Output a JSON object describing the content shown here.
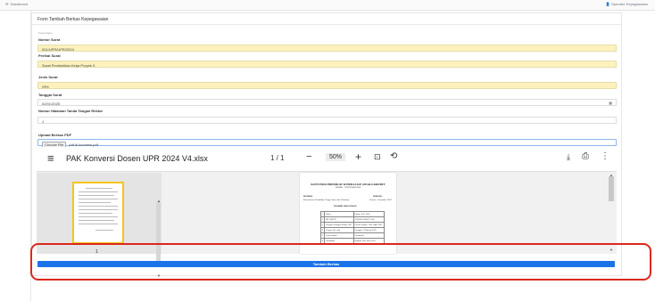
{
  "topbar": {
    "breadcrumb": "Dashboard",
    "user": "Operator Kepegawaian"
  },
  "form": {
    "header": "Form Tambah Berkas Kepegawaian",
    "section_label": "Keterangan",
    "nomor_surat": {
      "label": "Nomor Surat",
      "value": "001/UPR/UPR/2024"
    },
    "perihal_surat": {
      "label": "Perihal Surat",
      "value": "Surat Pembuktian Kerja Proyek X"
    },
    "jenis_surat": {
      "label": "Jenis Surat",
      "value": "SPK"
    },
    "tanggal_surat": {
      "label": "Tanggal Surat",
      "value": "02/01/2025"
    },
    "nomor_halaman": {
      "label": "Nomor Halaman Tanda Tangan Rektor",
      "value": "1"
    },
    "upload": {
      "label": "Upload Berkas PDF",
      "button": "Choose File",
      "filename": "pdf di konversi.pdf"
    },
    "submit_label": "Tambah Berkas"
  },
  "pdf_viewer": {
    "title": "PAK Konversi Dosen UPR 2024 V4.xlsx",
    "page_current": "1",
    "page_total": "1",
    "zoom": "50%",
    "thumbnail_page": "1",
    "document": {
      "heading": "KONVERSI PREDIKAT KINERJA KE ANGKA KREDIT",
      "subheading": "NOMOR : 1793/UN24/KP/2024",
      "instansi_label": "INSTANSI :",
      "instansi_value": "Kementerian Pendidikan Tinggi, Sains dan Teknologi",
      "periode_label": "PERIODE :",
      "periode_value": "Januari - Desember 2024",
      "table_header": "PEGAWAI YANG DINILAI",
      "rows": [
        {
          "no": "1",
          "key": "Nama",
          "val": "Fiason, S.Si., M.Sc"
        },
        {
          "no": "2",
          "key": "NIP / NUPTK",
          "val": "19790619 200501 1 004"
        },
        {
          "no": "3",
          "key": "Pangkat, Golongan Ruang, TMT",
          "val": "Penata Tingkat I, III/d, 1 April 2012"
        },
        {
          "no": "4",
          "key": "Tempat, Tgl. Lahir",
          "val": "Pronggo, 17 Februari 1979"
        },
        {
          "no": "5",
          "key": "Jenis Kelamin",
          "val": "Perempuan"
        },
        {
          "no": "6",
          "key": "Pendidikan",
          "val": "Magister (S2), Sains 2011"
        }
      ]
    }
  },
  "icons": {
    "pdf_menu": "menu-icon",
    "zoom_out": "minus-icon",
    "zoom_in": "plus-icon",
    "fit": "fit-page-icon",
    "rotate": "rotate-icon",
    "download": "download-icon",
    "print": "print-icon",
    "more": "more-vertical-icon",
    "calendar": "calendar-icon"
  },
  "colors": {
    "primary": "#1a73e8",
    "field_yellow": "#fdf2bd",
    "annotation_red": "#d9281d",
    "thumb_border": "#f6c51b"
  }
}
